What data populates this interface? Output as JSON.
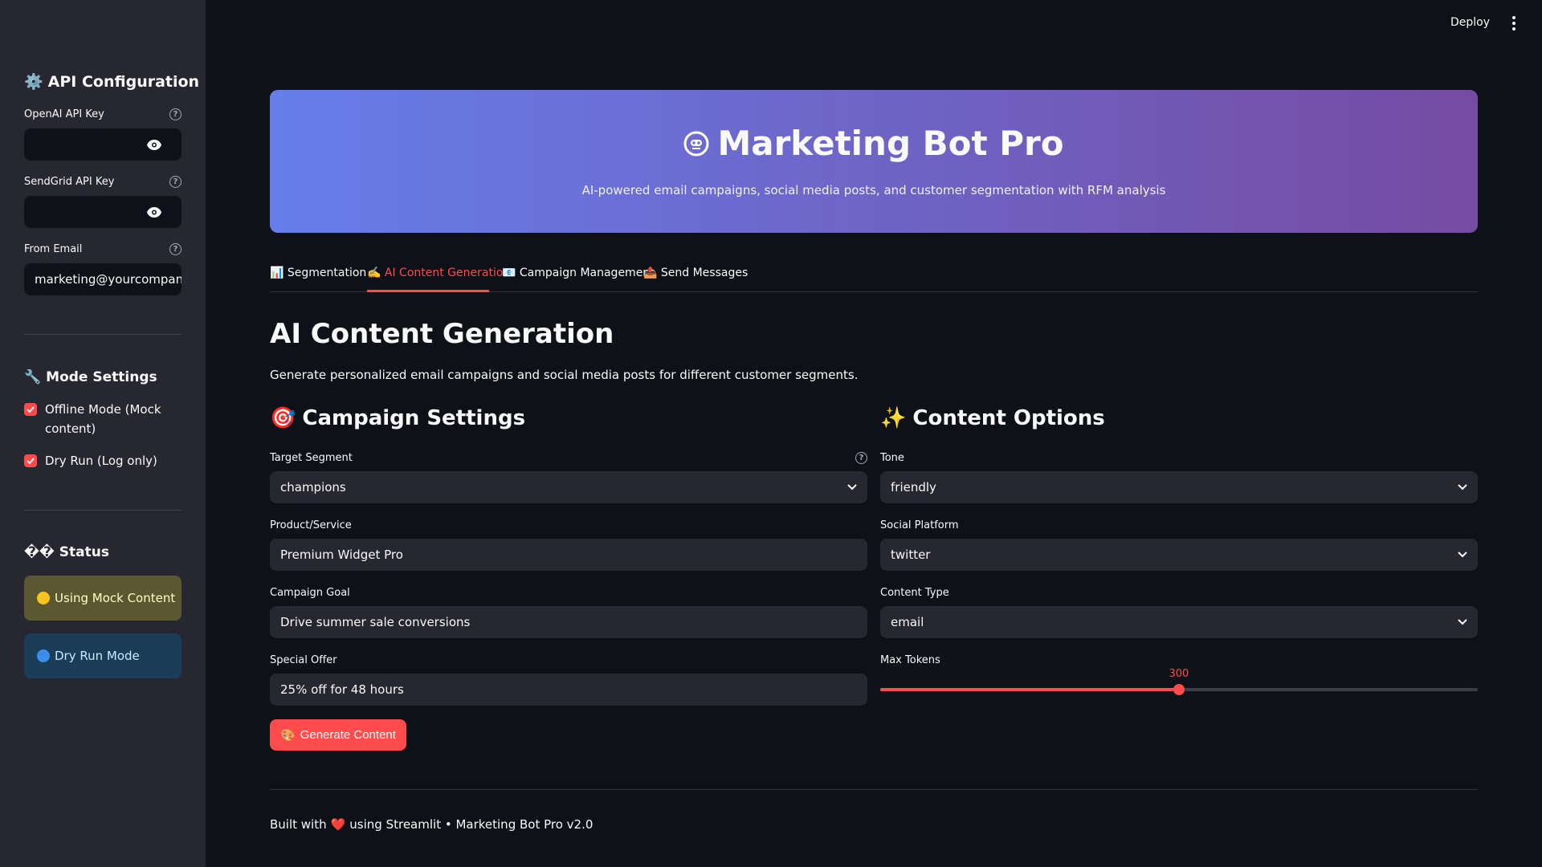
{
  "sidebar": {
    "api_config_title": "API Configuration",
    "openai_label": "OpenAI API Key",
    "openai_value": "",
    "sendgrid_label": "SendGrid API Key",
    "sendgrid_value": "",
    "from_email_label": "From Email",
    "from_email_value": "marketing@yourcompany.com",
    "mode_settings_title": "Mode Settings",
    "offline_mode_label": "Offline Mode (Mock content)",
    "offline_mode_checked": true,
    "dry_run_label": "Dry Run (Log only)",
    "dry_run_checked": true,
    "status_title": "�� Status",
    "status_mock": "Using Mock Content",
    "status_dry_run": "Dry Run Mode",
    "help_glyph": "?"
  },
  "topbar": {
    "deploy_label": "Deploy"
  },
  "hero": {
    "title": "Marketing Bot Pro",
    "subtitle": "AI-powered email campaigns, social media posts, and customer segmentation with RFM analysis"
  },
  "tabs": [
    {
      "icon": "📊",
      "label": "Segmentation"
    },
    {
      "icon": "✍️",
      "label": "AI Content Generation"
    },
    {
      "icon": "📧",
      "label": "Campaign Management"
    },
    {
      "icon": "📤",
      "label": "Send Messages"
    }
  ],
  "active_tab": 1,
  "main": {
    "title": "AI Content Generation",
    "description": "Generate personalized email campaigns and social media posts for different customer segments.",
    "campaign_settings": {
      "icon": "🎯",
      "title": "Campaign Settings",
      "target_segment_label": "Target Segment",
      "target_segment_value": "champions",
      "product_label": "Product/Service",
      "product_value": "Premium Widget Pro",
      "goal_label": "Campaign Goal",
      "goal_value": "Drive summer sale conversions",
      "offer_label": "Special Offer",
      "offer_value": "25% off for 48 hours",
      "generate_icon": "🎨",
      "generate_label": "Generate Content"
    },
    "content_options": {
      "icon": "✨",
      "title": "Content Options",
      "tone_label": "Tone",
      "tone_value": "friendly",
      "platform_label": "Social Platform",
      "platform_value": "twitter",
      "content_type_label": "Content Type",
      "content_type_value": "email",
      "max_tokens_label": "Max Tokens",
      "max_tokens_value": "300",
      "max_tokens_fraction": 0.5
    }
  },
  "footer": {
    "prefix": "Built with",
    "heart": "❤️",
    "suffix": "using Streamlit • Marketing Bot Pro v2.0"
  },
  "colors": {
    "accent": "#ff4b4b",
    "background": "#0e1117",
    "sidebar": "#262730",
    "hero_start": "#667eea",
    "hero_end": "#764ba2"
  }
}
